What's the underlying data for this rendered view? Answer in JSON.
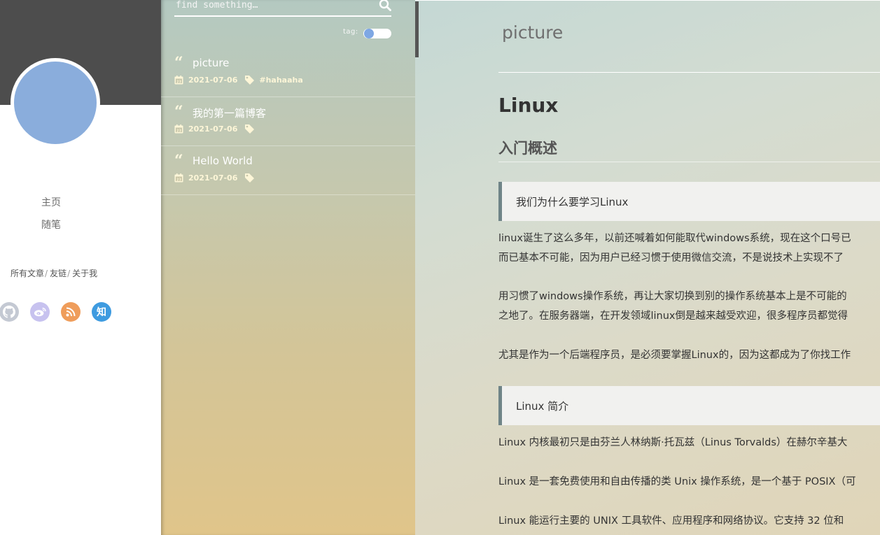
{
  "profile": {
    "nav": [
      "主页",
      "随笔"
    ],
    "links": [
      "所有文章",
      "友链",
      "关于我"
    ],
    "link_separator": "/",
    "social": [
      {
        "icon": "github-icon",
        "color": "#c4c9d3"
      },
      {
        "icon": "weibo-icon",
        "color": "#c7c2ef"
      },
      {
        "icon": "rss-icon",
        "color": "#ef9d5b"
      },
      {
        "icon": "zhihu-icon",
        "label": "知",
        "color": "#3e9be0"
      }
    ]
  },
  "search": {
    "placeholder": "find something…"
  },
  "tag_toggle": {
    "label": "tag:",
    "on": false
  },
  "posts": [
    {
      "title": "picture",
      "date": "2021-07-06",
      "tag": "#hahaaha"
    },
    {
      "title": "我的第一篇博客",
      "date": "2021-07-06",
      "tag": ""
    },
    {
      "title": "Hello World",
      "date": "2021-07-06",
      "tag": ""
    }
  ],
  "article": {
    "title": "picture",
    "h1": "Linux",
    "h2": "入门概述",
    "quote1": "我们为什么要学习Linux",
    "p1_line1": "linux诞生了这么多年，以前还喊着如何能取代windows系统，现在这个口号已",
    "p1_line2": "而已基本不可能，因为用户已经习惯于使用微信交流，不是说技术上实现不了",
    "p2_line1": "用习惯了windows操作系统，再让大家切换到别的操作系统基本上是不可能的",
    "p2_line2": "之地了。在服务器端，在开发领域linux倒是越来越受欢迎，很多程序员都觉得",
    "p3": "尤其是作为一个后端程序员，是必须要掌握Linux的，因为这都成为了你找工作",
    "quote2": "Linux 简介",
    "p4": "Linux 内核最初只是由芬兰人林纳斯·托瓦兹（Linus Torvalds）在赫尔辛基大",
    "p5": "Linux 是一套免费使用和自由传播的类 Unix 操作系统，是一个基于 POSIX（可",
    "p6": "Linux 能运行主要的 UNIX 工具软件、应用程序和网络协议。它支持 32 位和"
  }
}
